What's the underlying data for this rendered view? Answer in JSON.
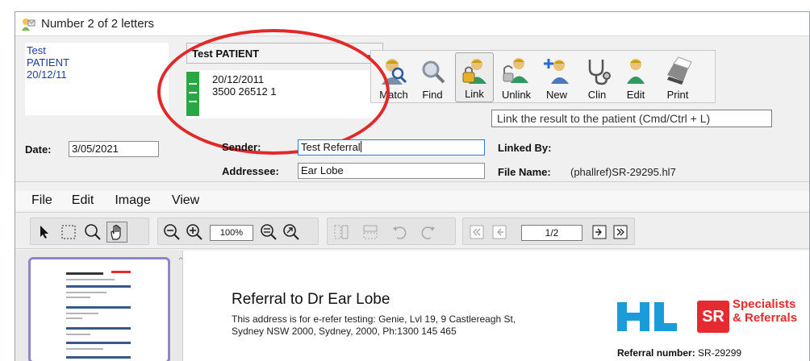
{
  "window": {
    "title": "Number 2 of 2 letters"
  },
  "patient_card": {
    "line1": "Test",
    "line2": "PATIENT",
    "line3": "20/12/11"
  },
  "patient_select": {
    "value": "Test PATIENT"
  },
  "patient_detail": {
    "dob": "20/12/2011",
    "number": "3500 26512 1"
  },
  "toolbar": {
    "buttons": [
      {
        "label": "Match",
        "icon": "match-person-icon"
      },
      {
        "label": "Find",
        "icon": "magnifier-icon"
      },
      {
        "label": "Link",
        "icon": "lock-person-icon"
      },
      {
        "label": "Unlink",
        "icon": "unlink-person-icon"
      },
      {
        "label": "New",
        "icon": "add-person-icon"
      },
      {
        "label": "Clin",
        "icon": "stethoscope-icon"
      },
      {
        "label": "Edit",
        "icon": "edit-person-icon"
      },
      {
        "label": "Print",
        "icon": "printer-icon"
      }
    ],
    "tooltip": "Link the result to the patient (Cmd/Ctrl + L)"
  },
  "fields": {
    "date_label": "Date:",
    "date_value": "3/05/2021",
    "sender_label": "Sender:",
    "sender_value": "Test Referral",
    "addressee_label": "Addressee:",
    "addressee_value": "Ear Lobe",
    "linked_by_label": "Linked By:",
    "file_name_label": "File Name:",
    "file_name_value": "(phallref)SR-29295.hl7"
  },
  "menu": {
    "items": [
      "File",
      "Edit",
      "Image",
      "View"
    ]
  },
  "viewer_toolbar": {
    "zoom": "100%",
    "page": "1/2"
  },
  "document": {
    "title": "Referral to Dr Ear Lobe",
    "address_line1": "This address is for e-refer testing: Genie, Lvl 19, 9 Castlereagh St,",
    "address_line2": "Sydney NSW 2000, Sydney, 2000, Ph:1300 145 465",
    "logo_hl": "HL",
    "logo_sr_box": "SR",
    "logo_sr_line1": "Specialists",
    "logo_sr_line2": "& Referrals",
    "referral_label": "Referral number:",
    "referral_value": "SR-29299"
  },
  "colors": {
    "annotation": "#e2292a",
    "patient_text": "#1f3c9a",
    "status_green": "#27a845",
    "brand_red": "#e52b2f",
    "brand_blue": "#1b9bd7"
  }
}
